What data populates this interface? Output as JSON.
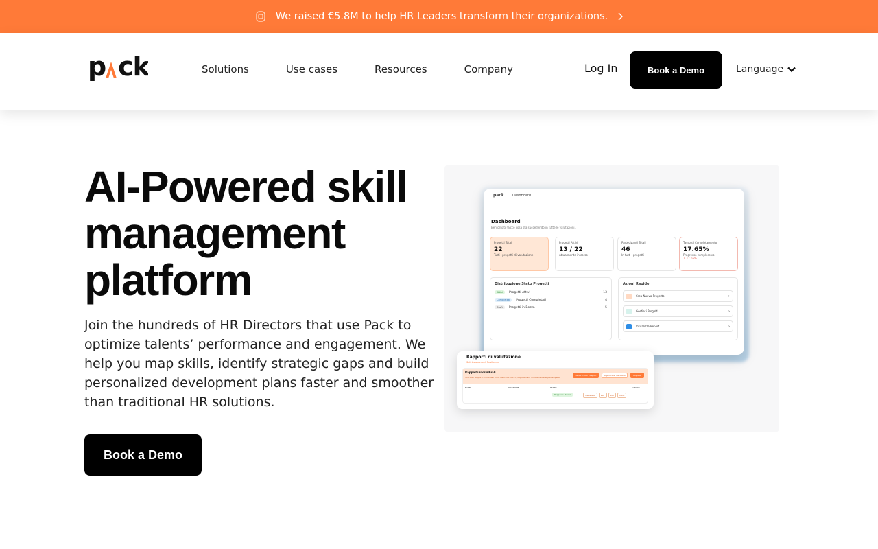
{
  "announcement": {
    "text": "We raised €5.8M to help HR Leaders transform their organizations.",
    "icon": "badge-icon",
    "link_icon": "chevron-right-icon",
    "bg_color": "#ff7a38"
  },
  "header": {
    "logo": "pack",
    "nav": [
      {
        "label": "Solutions"
      },
      {
        "label": "Use cases"
      },
      {
        "label": "Resources"
      },
      {
        "label": "Company"
      }
    ],
    "login": "Log In",
    "book_demo": "Book a Demo",
    "language": "Language"
  },
  "hero": {
    "title": "AI-Powered skill management platform",
    "subtitle": "Join the hundreds of HR Directors that use Pack to optimize talents’ performance and engagement. We help you map skills, identify strategic gaps and build personalized development plans faster and smoother than traditional HR solutions.",
    "cta": "Book a Demo"
  },
  "dashboard": {
    "breadcrumb": "Dashboard",
    "logo": "pack",
    "title": "Dashboard",
    "subtitle": "Bentornato! Ecco cosa sta succedendo in tutte le valutazioni.",
    "stats": [
      {
        "label": "Progetti Totali",
        "value": "22",
        "note": "Tutti i progetti di valutazione"
      },
      {
        "label": "Progetti Attivi",
        "value": "13 / 22",
        "note": "Attualmente in corso"
      },
      {
        "label": "Partecipanti Totali",
        "value": "46",
        "note": "In tutti i progetti"
      },
      {
        "label": "Tasso di Completamento",
        "value": "17.65%",
        "note": "Progresso complessivo",
        "trend": "↓ 17.65%"
      }
    ],
    "distribution": {
      "title": "Distribuzione Stato Progetti",
      "rows": [
        {
          "tag": "Attivi",
          "label": "Progetti Attivi",
          "value": "13"
        },
        {
          "tag": "Completati",
          "label": "Progetti Completati",
          "value": "4"
        },
        {
          "tag": "Draft",
          "label": "Progetti in Bozza",
          "value": "5"
        }
      ]
    },
    "quick_actions": {
      "title": "Azioni Rapide",
      "items": [
        {
          "label": "Crea Nuovo Progetto"
        },
        {
          "label": "Gestisci Progetti"
        },
        {
          "label": "Visualizza Report"
        }
      ]
    }
  },
  "report": {
    "title": "Rapporti di valutazione",
    "subtitle": "Self Assessment Resilience",
    "box_label": "Rapporti individuali",
    "box_desc": "Scarica i rapporti individuali in formato PDF o PPT, oppure invia direttamente ai partecipanti",
    "buttons": [
      "Genera tutti i Report",
      "Rigenerare mancanti",
      "Esporta"
    ],
    "columns": [
      "NOME",
      "POSIZIONE",
      "STATO",
      "AZIONI"
    ],
    "status": "Rapporto Pronto",
    "actions": [
      "Visualizza",
      "PDF",
      "PPT",
      "Invia"
    ]
  }
}
